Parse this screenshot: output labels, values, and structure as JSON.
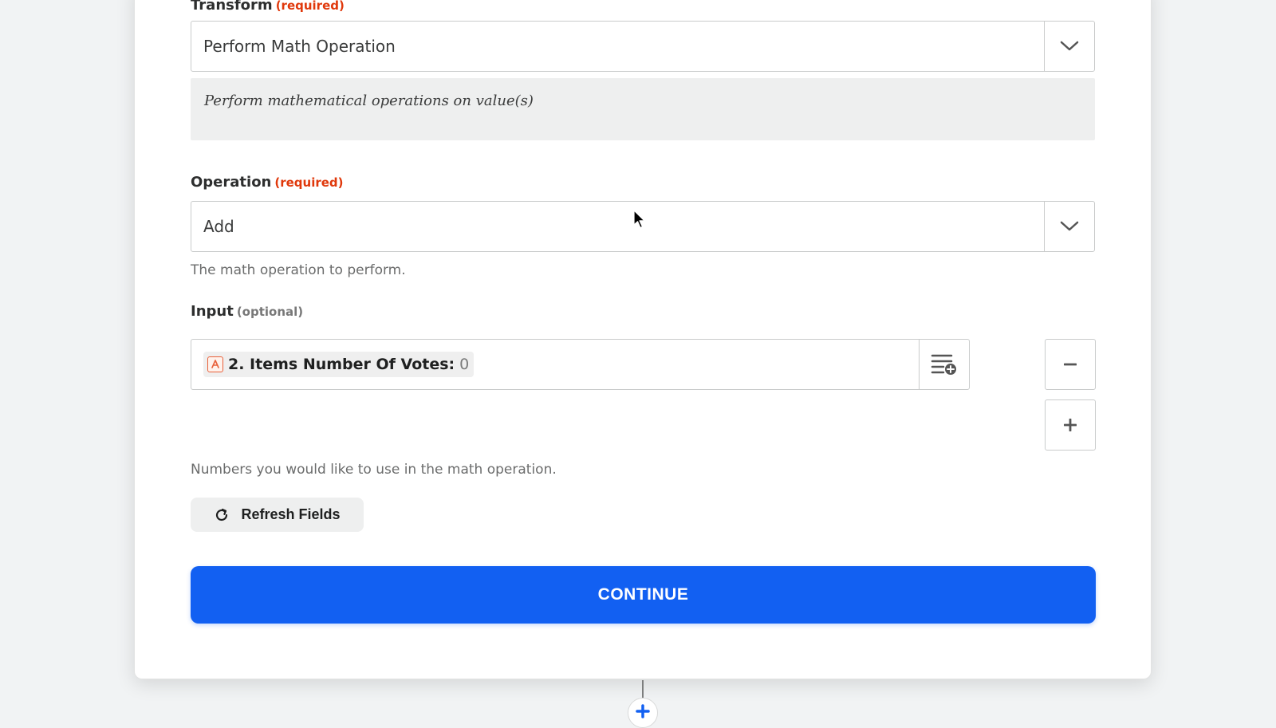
{
  "transform": {
    "label": "Transform",
    "required": "(required)",
    "value": "Perform Math Operation",
    "description": "Perform mathematical operations on value(s)"
  },
  "operation": {
    "label": "Operation",
    "required": "(required)",
    "value": "Add",
    "help": "The math operation to perform."
  },
  "input": {
    "label": "Input",
    "optional": "(optional)",
    "pill_label": "2. Items Number Of Votes:",
    "pill_value": "0",
    "help": "Numbers you would like to use in the math operation."
  },
  "buttons": {
    "refresh": "Refresh Fields",
    "continue": "CONTINUE"
  },
  "colors": {
    "accent": "#1260f2",
    "required": "#e0380b"
  }
}
